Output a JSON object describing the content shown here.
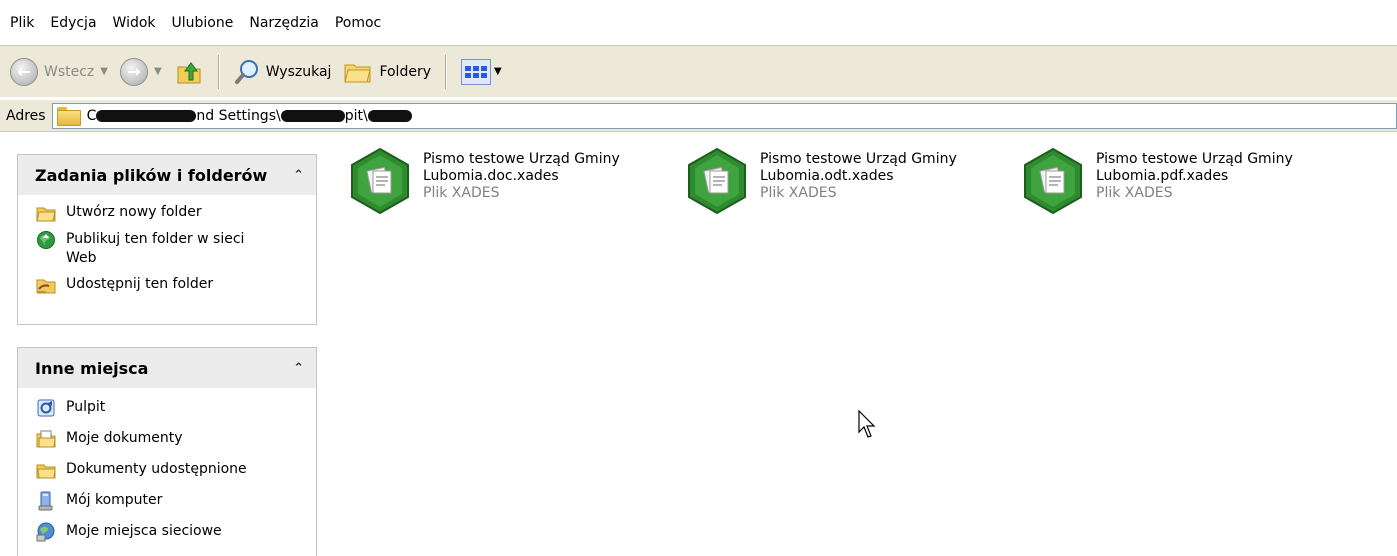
{
  "menu": {
    "items": [
      "Plik",
      "Edycja",
      "Widok",
      "Ulubione",
      "Narzędzia",
      "Pomoc"
    ]
  },
  "toolbar": {
    "back_label": "Wstecz",
    "search_label": "Wyszukaj",
    "folders_label": "Foldery"
  },
  "address": {
    "label": "Adres",
    "visible_fragments": [
      "C",
      "nd Settings\\",
      "pit\\"
    ]
  },
  "tasks_pane": {
    "title": "Zadania plików i folderów",
    "items": [
      {
        "label": "Utwórz nowy folder",
        "icon": "new-folder-icon"
      },
      {
        "label": "Publikuj ten folder w sieci Web",
        "icon": "publish-web-icon"
      },
      {
        "label": "Udostępnij ten folder",
        "icon": "share-folder-icon"
      }
    ]
  },
  "places_pane": {
    "title": "Inne miejsca",
    "items": [
      {
        "label": "Pulpit",
        "icon": "desktop-icon"
      },
      {
        "label": "Moje dokumenty",
        "icon": "my-documents-icon"
      },
      {
        "label": "Dokumenty udostępnione",
        "icon": "shared-documents-icon"
      },
      {
        "label": "Mój komputer",
        "icon": "my-computer-icon"
      },
      {
        "label": "Moje miejsca sieciowe",
        "icon": "network-places-icon"
      }
    ]
  },
  "files": [
    {
      "line1": "Pismo testowe Urząd Gminy",
      "line2": "Lubomia.doc.xades",
      "type": "Plik XADES"
    },
    {
      "line1": "Pismo testowe Urząd Gminy",
      "line2": "Lubomia.odt.xades",
      "type": "Plik XADES"
    },
    {
      "line1": "Pismo testowe Urząd Gminy",
      "line2": "Lubomia.pdf.xades",
      "type": "Plik XADES"
    }
  ],
  "colors": {
    "file_icon_green": "#2e8b2e",
    "chrome_bg": "#ece9d8",
    "pane_header_bg": "#ececec",
    "muted_text": "#808080"
  }
}
